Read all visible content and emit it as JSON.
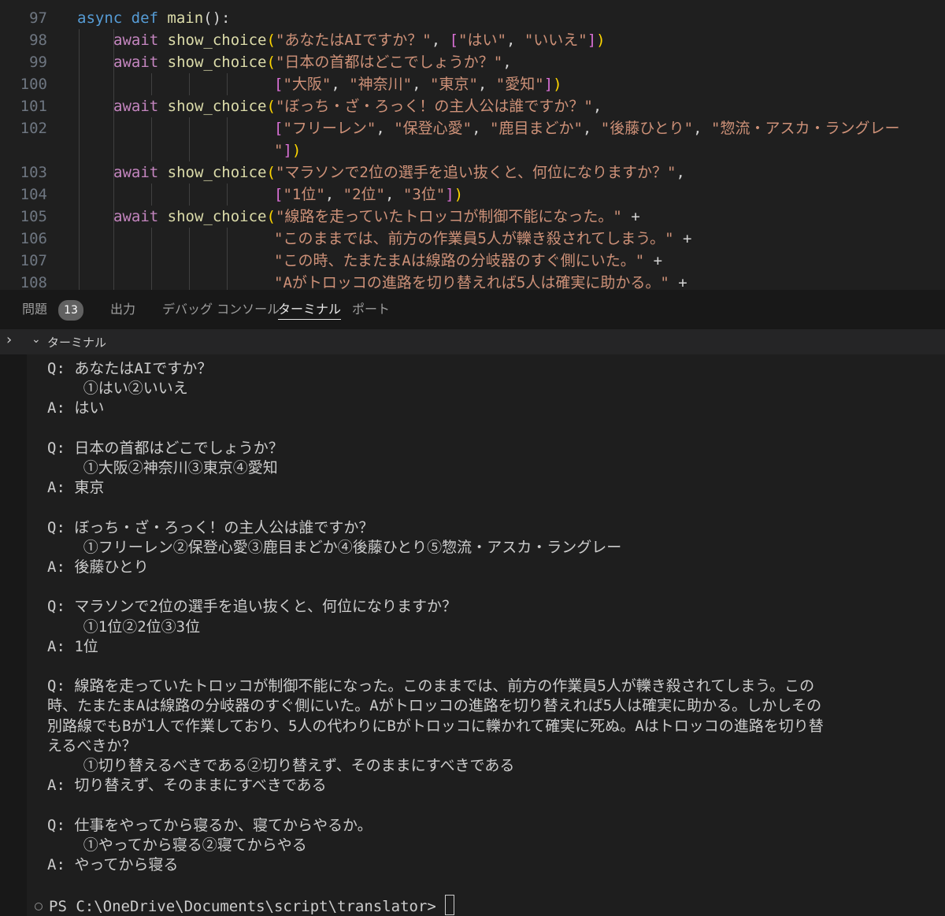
{
  "editor": {
    "lines": [
      {
        "num": "97",
        "parts": [
          [
            "kw",
            "async "
          ],
          [
            "kw",
            "def "
          ],
          [
            "fn",
            "main"
          ],
          [
            "op",
            "():"
          ]
        ]
      },
      {
        "num": "98",
        "parts": [
          [
            "kwc",
            "await "
          ],
          [
            "fn",
            "show_choice"
          ],
          [
            "b1",
            "("
          ],
          [
            "str",
            "\"あなたはAIですか？\""
          ],
          [
            "op",
            ", "
          ],
          [
            "b2",
            "["
          ],
          [
            "str",
            "\"はい\""
          ],
          [
            "op",
            ", "
          ],
          [
            "str",
            "\"いいえ\""
          ],
          [
            "b2",
            "]"
          ],
          [
            "b1",
            ")"
          ]
        ]
      },
      {
        "num": "99",
        "parts": [
          [
            "kwc",
            "await "
          ],
          [
            "fn",
            "show_choice"
          ],
          [
            "b1",
            "("
          ],
          [
            "str",
            "\"日本の首都はどこでしょうか？\""
          ],
          [
            "op",
            ","
          ]
        ]
      },
      {
        "num": "100",
        "parts": [
          [
            "b2",
            "["
          ],
          [
            "str",
            "\"大阪\""
          ],
          [
            "op",
            ", "
          ],
          [
            "str",
            "\"神奈川\""
          ],
          [
            "op",
            ", "
          ],
          [
            "str",
            "\"東京\""
          ],
          [
            "op",
            ", "
          ],
          [
            "str",
            "\"愛知\""
          ],
          [
            "b2",
            "]"
          ],
          [
            "b1",
            ")"
          ]
        ]
      },
      {
        "num": "101",
        "parts": [
          [
            "kwc",
            "await "
          ],
          [
            "fn",
            "show_choice"
          ],
          [
            "b1",
            "("
          ],
          [
            "str",
            "\"ぼっち・ざ・ろっく！の主人公は誰ですか？\""
          ],
          [
            "op",
            ","
          ]
        ]
      },
      {
        "num": "102",
        "parts": [
          [
            "b2",
            "["
          ],
          [
            "str",
            "\"フリーレン\""
          ],
          [
            "op",
            ", "
          ],
          [
            "str",
            "\"保登心愛\""
          ],
          [
            "op",
            ", "
          ],
          [
            "str",
            "\"鹿目まどか\""
          ],
          [
            "op",
            ", "
          ],
          [
            "str",
            "\"後藤ひとり\""
          ],
          [
            "op",
            ", "
          ],
          [
            "str",
            "\"惣流・アスカ・ラングレー"
          ]
        ]
      },
      {
        "num": "",
        "parts": [
          [
            "str",
            "\""
          ],
          [
            "b2",
            "]"
          ],
          [
            "b1",
            ")"
          ]
        ]
      },
      {
        "num": "103",
        "parts": [
          [
            "kwc",
            "await "
          ],
          [
            "fn",
            "show_choice"
          ],
          [
            "b1",
            "("
          ],
          [
            "str",
            "\"マラソンで2位の選手を追い抜くと、何位になりますか？\""
          ],
          [
            "op",
            ","
          ]
        ]
      },
      {
        "num": "104",
        "parts": [
          [
            "b2",
            "["
          ],
          [
            "str",
            "\"1位\""
          ],
          [
            "op",
            ", "
          ],
          [
            "str",
            "\"2位\""
          ],
          [
            "op",
            ", "
          ],
          [
            "str",
            "\"3位\""
          ],
          [
            "b2",
            "]"
          ],
          [
            "b1",
            ")"
          ]
        ]
      },
      {
        "num": "105",
        "parts": [
          [
            "kwc",
            "await "
          ],
          [
            "fn",
            "show_choice"
          ],
          [
            "b1",
            "("
          ],
          [
            "str",
            "\"線路を走っていたトロッコが制御不能になった。\""
          ],
          [
            "op",
            " +"
          ]
        ]
      },
      {
        "num": "106",
        "parts": [
          [
            "str",
            "\"このままでは、前方の作業員5人が轢き殺されてしまう。\""
          ],
          [
            "op",
            " +"
          ]
        ]
      },
      {
        "num": "107",
        "parts": [
          [
            "str",
            "\"この時、たまたまAは線路の分岐器のすぐ側にいた。\""
          ],
          [
            "op",
            " +"
          ]
        ]
      },
      {
        "num": "108",
        "parts": [
          [
            "str",
            "\"Aがトロッコの進路を切り替えれば5人は確実に助かる。\""
          ],
          [
            "op",
            " +"
          ]
        ]
      }
    ]
  },
  "panel": {
    "tabs": [
      {
        "label": "問題",
        "badge": "13"
      },
      {
        "label": "出力"
      },
      {
        "label": "デバッグ コンソール"
      },
      {
        "label": "ターミナル",
        "active": true
      },
      {
        "label": "ポート"
      }
    ],
    "terminal_title": "ターミナル"
  },
  "terminal": {
    "lines": [
      "Q: あなたはAIですか？",
      "    ①はい②いいえ",
      "A: はい",
      "",
      "Q: 日本の首都はどこでしょうか？",
      "    ①大阪②神奈川③東京④愛知",
      "A: 東京",
      "",
      "Q: ぼっち・ざ・ろっく！の主人公は誰ですか？",
      "    ①フリーレン②保登心愛③鹿目まどか④後藤ひとり⑤惣流・アスカ・ラングレー",
      "A: 後藤ひとり",
      "",
      "Q: マラソンで2位の選手を追い抜くと、何位になりますか？",
      "    ①1位②2位③3位",
      "A: 1位",
      "",
      "Q: 線路を走っていたトロッコが制御不能になった。このままでは、前方の作業員5人が轢き殺されてしまう。この",
      "時、たまたまAは線路の分岐器のすぐ側にいた。Aがトロッコの進路を切り替えれば5人は確実に助かる。しかしその",
      "別路線でもBが1人で作業しており、5人の代わりにBがトロッコに轢かれて確実に死ぬ。Aはトロッコの進路を切り替",
      "えるべきか？",
      "    ①切り替えるべきである②切り替えず、そのままにすべきである",
      "A: 切り替えず、そのままにすべきである",
      "",
      "Q: 仕事をやってから寝るか、寝てからやるか。",
      "    ①やってから寝る②寝てからやる",
      "A: やってから寝る",
      ""
    ],
    "prompt": "PS C:\\OneDrive\\Documents\\script\\translator> "
  },
  "colors": {
    "keyword": "#569cd6",
    "control_keyword": "#c586c0",
    "function": "#dcdcaa",
    "string": "#ce9178",
    "bracket_1": "#ffd700",
    "bracket_2": "#da70d6"
  }
}
